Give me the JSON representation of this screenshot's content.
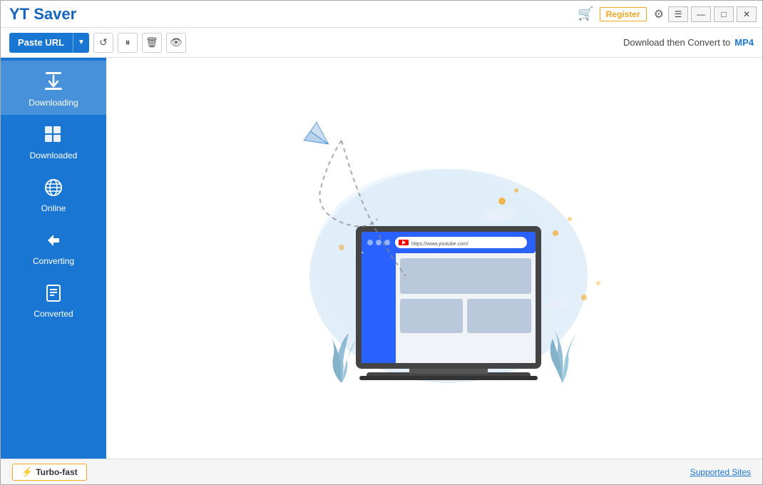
{
  "app": {
    "title": "YT Saver"
  },
  "titlebar": {
    "cart_label": "🛒",
    "register_label": "Register",
    "settings_label": "⚙",
    "hamburger_label": "☰",
    "minimize_label": "—",
    "maximize_label": "□",
    "close_label": "✕"
  },
  "toolbar": {
    "paste_url_label": "Paste URL",
    "paste_url_arrow": "▼",
    "refresh_label": "↺",
    "pause_label": "⏸",
    "delete_label": "🗑",
    "eye_label": "👁",
    "convert_text": "Download then Convert to",
    "convert_format": "MP4"
  },
  "sidebar": {
    "items": [
      {
        "id": "downloading",
        "label": "Downloading",
        "icon": "⬇",
        "active": true
      },
      {
        "id": "downloaded",
        "label": "Downloaded",
        "icon": "▦"
      },
      {
        "id": "online",
        "label": "Online",
        "icon": "🌐"
      },
      {
        "id": "converting",
        "label": "Converting",
        "icon": "↗"
      },
      {
        "id": "converted",
        "label": "Converted",
        "icon": "📋"
      }
    ]
  },
  "browser": {
    "url": "https://www.youtube.com/"
  },
  "bottombar": {
    "turbo_icon": "⚡",
    "turbo_label": "Turbo-fast",
    "supported_sites": "Supported Sites"
  }
}
